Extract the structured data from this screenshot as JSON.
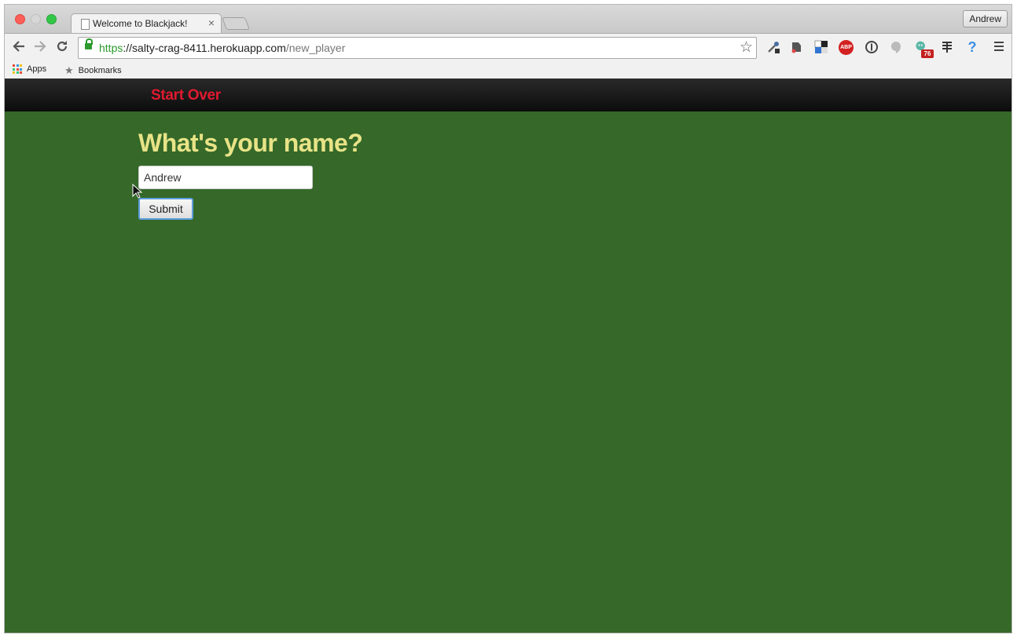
{
  "browser": {
    "tab_title": "Welcome to Blackjack!",
    "tab_close": "×",
    "profile_name": "Andrew",
    "url_scheme": "https",
    "url_host": "://salty-crag-8411.herokuapp.com",
    "url_path": "/new_player",
    "bookmarks": [
      {
        "label": "Apps"
      },
      {
        "label": "Bookmarks"
      }
    ],
    "extensions": [
      "eyedropper-icon",
      "evernote-icon",
      "delicious-icon",
      "adblock-icon",
      "onepassword-icon",
      "hangouts-icon",
      "octotree-icon",
      "wappalyzer-icon",
      "help-icon"
    ],
    "extension_badge": "76",
    "adblock_label": "ABP",
    "help_label": "?"
  },
  "page": {
    "nav_link": "Start Over",
    "heading": "What's your name?",
    "name_value": "Andrew",
    "submit_label": "Submit"
  },
  "colors": {
    "page_background": "#356829",
    "heading": "#e8e387",
    "nav_link": "#e01a2f"
  }
}
